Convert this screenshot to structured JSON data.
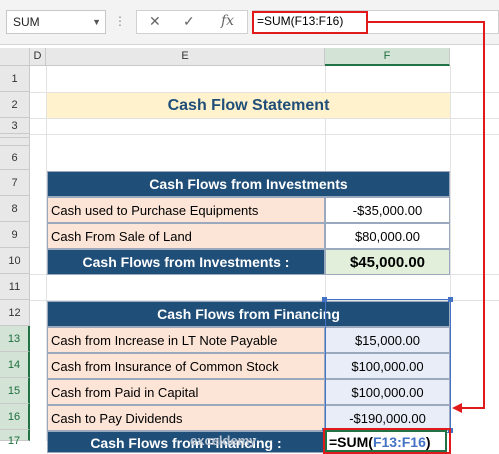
{
  "formula_bar": {
    "name_box": "SUM",
    "cancel_icon": "✕",
    "enter_icon": "✓",
    "fx_label": "fx",
    "formula": "=SUM(F13:F16)"
  },
  "columns": [
    "D",
    "E",
    "F"
  ],
  "rows": [
    "1",
    "2",
    "3",
    "",
    "",
    "6",
    "7",
    "8",
    "9",
    "10",
    "11",
    "12",
    "13",
    "14",
    "15",
    "16",
    "17"
  ],
  "sheet": {
    "title": "Cash Flow Statement",
    "investments": {
      "header": "Cash Flows from Investments",
      "rows": [
        {
          "label": "Cash used to Purchase Equipments",
          "value": "-$35,000.00"
        },
        {
          "label": "Cash From Sale of Land",
          "value": "$80,000.00"
        }
      ],
      "total_label": "Cash Flows from Investments :",
      "total_value": "$45,000.00"
    },
    "financing": {
      "header": "Cash Flows from Financing",
      "rows": [
        {
          "label": "Cash from Increase in LT Note Payable",
          "value": "$15,000.00"
        },
        {
          "label": "Cash from Insurance of Common Stock",
          "value": "$100,000.00"
        },
        {
          "label": "Cash from Paid in Capital",
          "value": "$100,000.00"
        },
        {
          "label": "Cash to Pay Dividends",
          "value": "-$190,000.00"
        }
      ],
      "total_label": "Cash Flows from Financing :",
      "formula_prefix": "=SUM(",
      "formula_ref": "F13:F16",
      "formula_suffix": ")"
    }
  },
  "watermark": "exceldemy",
  "colors": {
    "accent_red": "#e0191b",
    "header_blue": "#1f4e79",
    "select_blue": "#4472c4"
  }
}
